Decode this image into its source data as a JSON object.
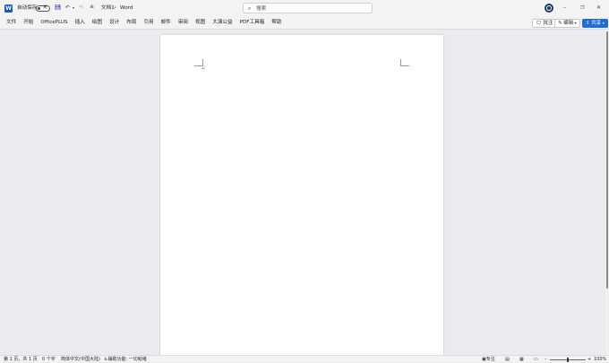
{
  "titlebar": {
    "app_logo": "W",
    "autosave_label": "自动保存",
    "autosave_state": "关",
    "filename": "文档1",
    "separator": "•",
    "app_name": "Word",
    "search_placeholder": "搜索",
    "more_symbol": "≚"
  },
  "ribbon": {
    "menu": [
      "文件",
      "开始",
      "OfficePLUS",
      "插入",
      "绘图",
      "设计",
      "布局",
      "引用",
      "邮件",
      "审阅",
      "视图",
      "大演公益",
      "PDF工具箱",
      "帮助"
    ],
    "comments_label": "批注",
    "editing_label": "编辑",
    "share_label": "共享"
  },
  "document": {
    "paragraph_mark": "↵"
  },
  "status": {
    "page_info": "第 1 页，共 1 页",
    "word_count": "0 个字",
    "language": "简体中文(中国大陆)",
    "accessibility": "辅助功能: 一切就绪",
    "focus": "专注",
    "zoom": "100%"
  },
  "colors": {
    "accent": "#1f6cd6",
    "word_blue": "#185abd"
  }
}
